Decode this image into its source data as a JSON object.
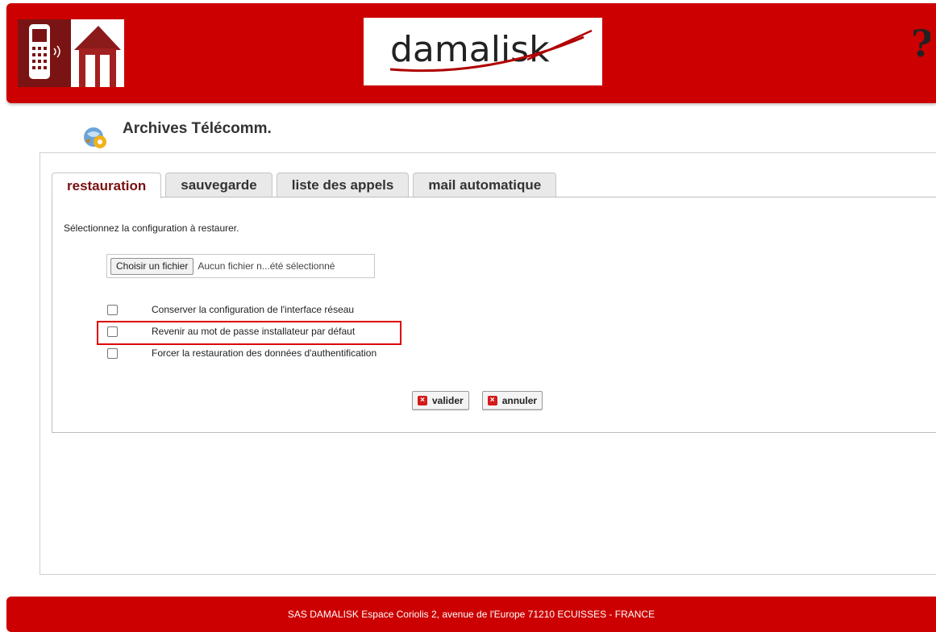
{
  "header": {
    "brand_text": "damalisk",
    "help_icon": "question-mark-icon"
  },
  "page": {
    "title": "Archives Télécomm.",
    "title_icon": "archive-globe-icon"
  },
  "tabs": [
    {
      "label": "restauration",
      "active": true
    },
    {
      "label": "sauvegarde",
      "active": false
    },
    {
      "label": "liste des appels",
      "active": false
    },
    {
      "label": "mail automatique",
      "active": false
    }
  ],
  "restore": {
    "instruction": "Sélectionnez la configuration à restaurer.",
    "file_button": "Choisir un fichier",
    "file_status": "Aucun fichier n...été sélectionné",
    "options": [
      {
        "label": "Conserver la configuration de l'interface réseau",
        "checked": false
      },
      {
        "label": "Revenir au mot de passe installateur par défaut",
        "checked": false
      },
      {
        "label": "Forcer la restauration des données d'authentification",
        "checked": false
      }
    ],
    "validate_label": "valider",
    "cancel_label": "annuler"
  },
  "footer": {
    "text": "SAS DAMALISK Espace Coriolis 2, avenue de l'Europe 71210 ECUISSES - FRANCE"
  },
  "colors": {
    "brand_red": "#cc0000",
    "active_tab_text": "#7a1010",
    "highlight": "#dd0000"
  }
}
